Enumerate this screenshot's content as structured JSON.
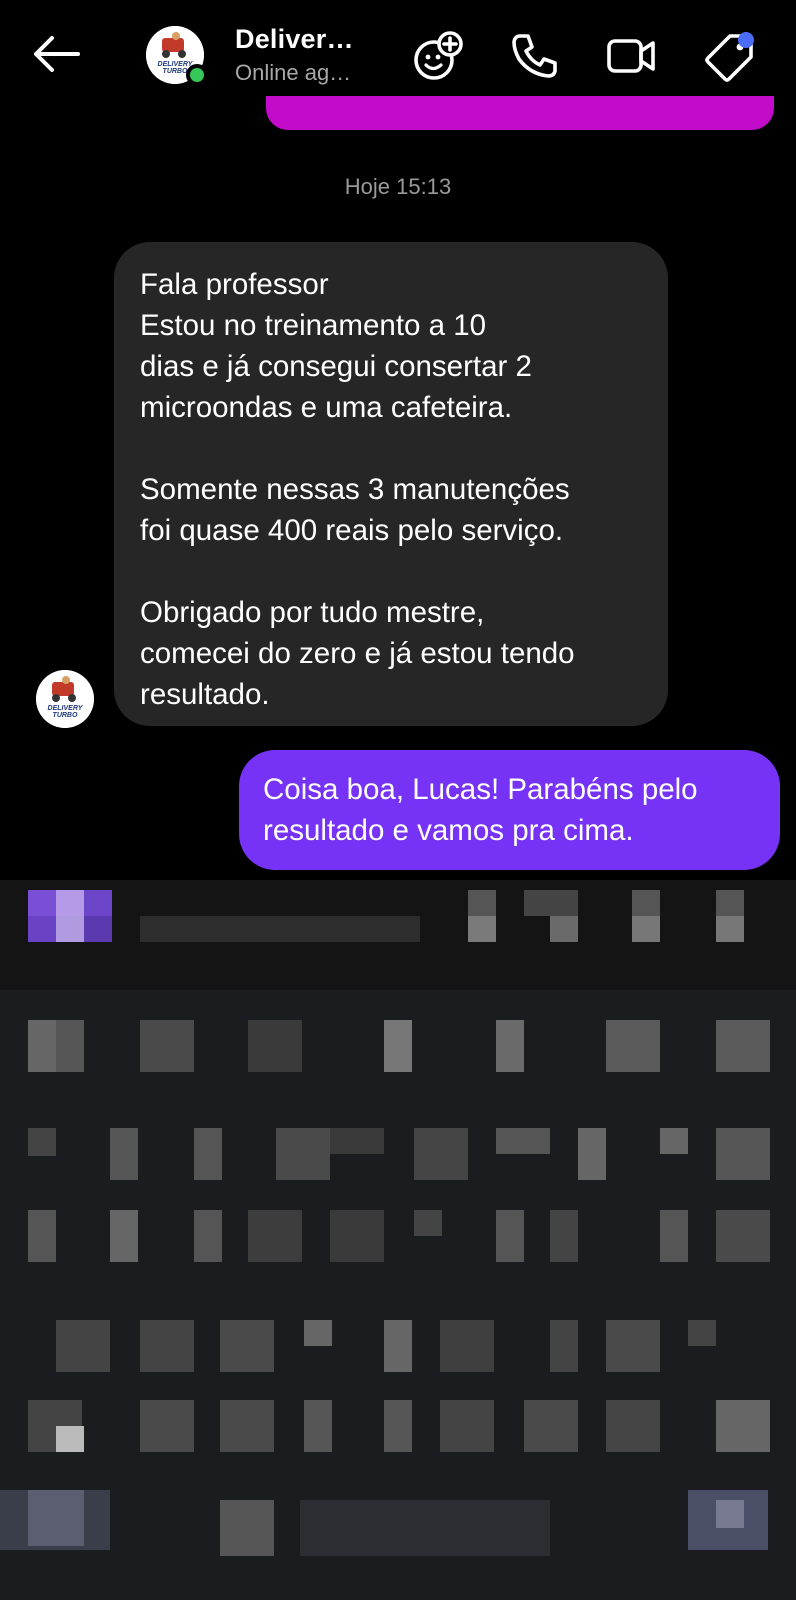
{
  "header": {
    "contact_name": "Deliver…",
    "status": "Online ag…",
    "icons": [
      "back-arrow-icon",
      "avatar-effects-icon",
      "phone-icon",
      "video-camera-icon",
      "tag-icon"
    ]
  },
  "conversation": {
    "timestamp": "Hoje 15:13",
    "incoming": {
      "avatar_logo_text": [
        "DELIVERY",
        "TURBO"
      ],
      "lines": [
        "Fala professor",
        "Estou no treinamento a 10",
        "dias e já consegui consertar 2",
        "microondas e uma cafeteira.",
        "",
        "Somente nessas 3 manutenções",
        "foi quase 400 reais pelo serviço.",
        "",
        "Obrigado por tudo mestre,",
        "comecei do zero e já estou tendo",
        "resultado."
      ]
    },
    "outgoing": {
      "lines": [
        "Coisa boa, Lucas! Parabéns pelo",
        "resultado e vamos pra cima."
      ]
    }
  },
  "colors": {
    "background": "#000000",
    "incoming_bubble": "#262626",
    "outgoing_bubble": "#7733f5",
    "previous_bubble": "#c20cc9",
    "online_indicator": "#35c759",
    "notification_dot": "#4a6cf7"
  }
}
